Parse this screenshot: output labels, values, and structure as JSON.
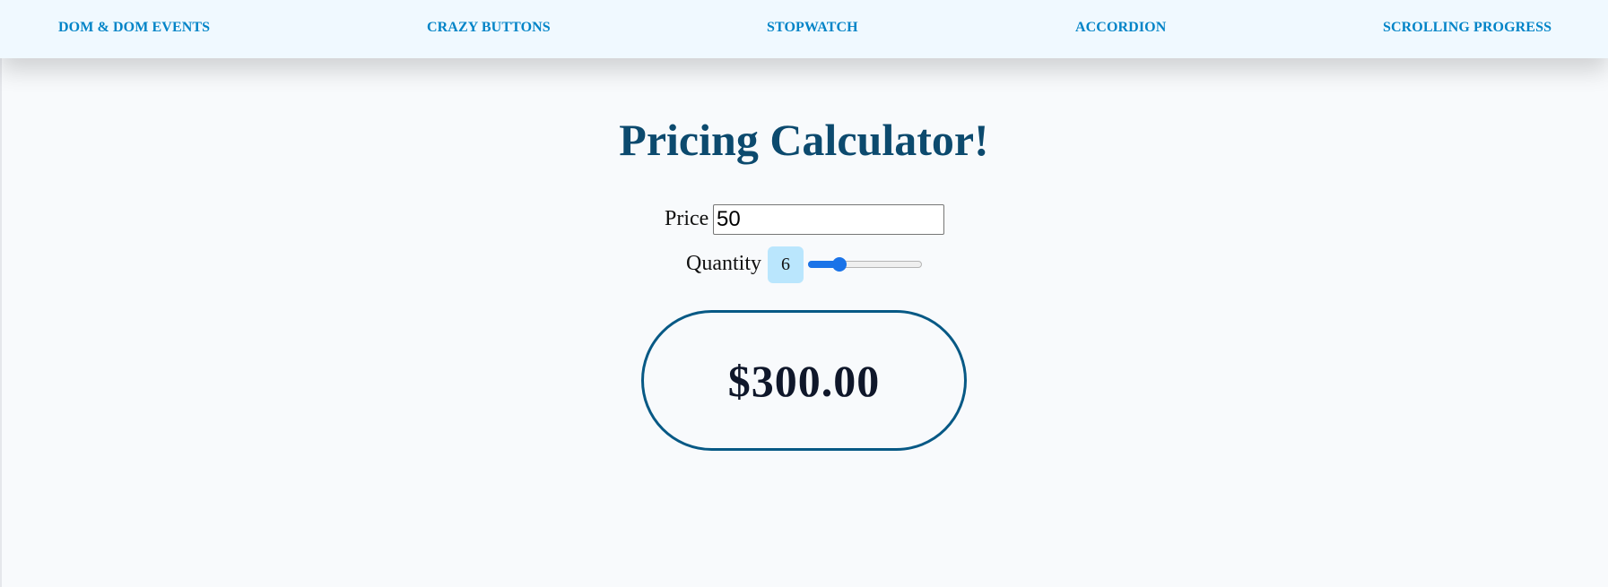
{
  "nav": {
    "items": [
      {
        "label": "DOM & DOM EVENTS"
      },
      {
        "label": "CRAZY BUTTONS"
      },
      {
        "label": "STOPWATCH"
      },
      {
        "label": "ACCORDION"
      },
      {
        "label": "SCROLLING PROGRESS"
      }
    ]
  },
  "main": {
    "title": "Pricing Calculator!",
    "price": {
      "label": "Price",
      "value": "50"
    },
    "quantity": {
      "label": "Quantity",
      "value": "6",
      "slider_fraction": 0.24
    },
    "total": "$300.00"
  },
  "colors": {
    "nav_bg": "#f0f9ff",
    "nav_link": "#0284c7",
    "title": "#0c4a6e",
    "badge_bg": "#bae6fd",
    "total_border": "#075985",
    "slider_accent": "#1a73e8"
  }
}
